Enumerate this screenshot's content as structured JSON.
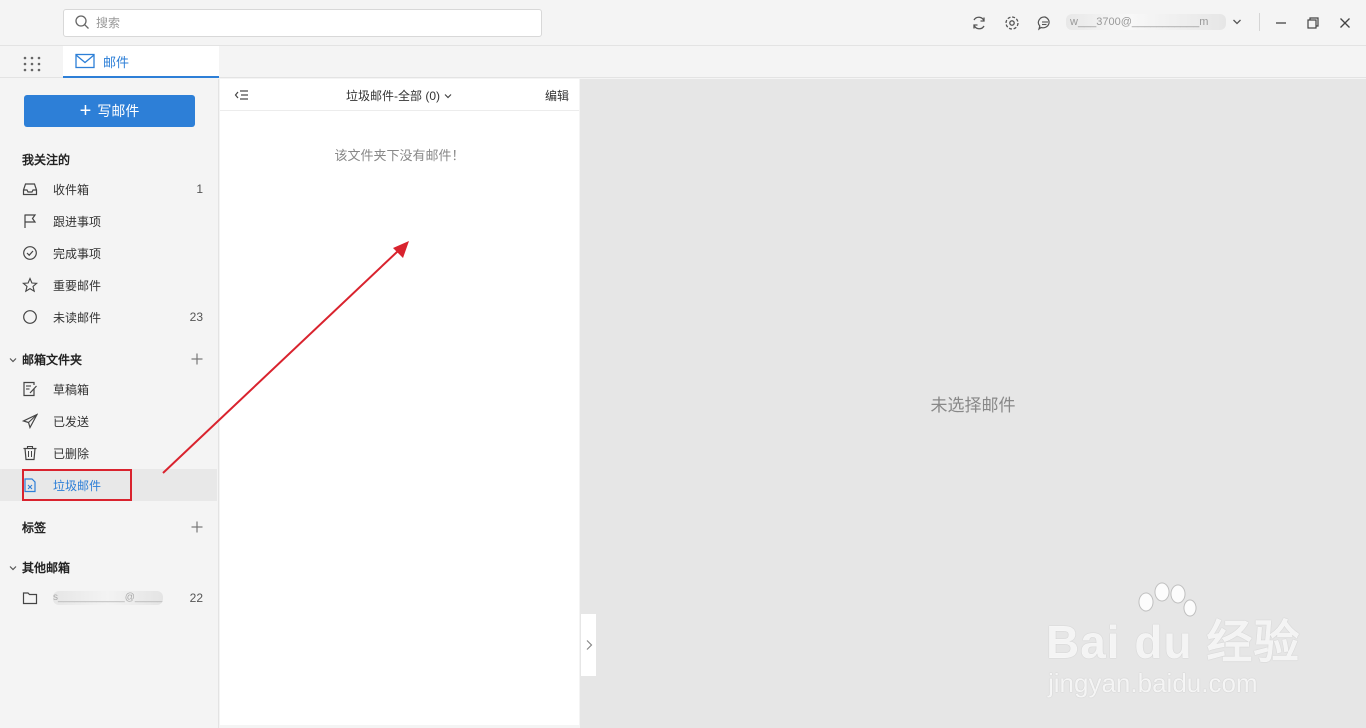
{
  "search": {
    "placeholder": "搜索"
  },
  "account": {
    "name": "w___3700@___________m"
  },
  "tabs": [
    {
      "label": "邮件"
    }
  ],
  "compose": {
    "label": "写邮件"
  },
  "sections": {
    "favorites": {
      "title": "我关注的",
      "items": [
        {
          "label": "收件箱",
          "count": "1",
          "icon": "inbox-icon"
        },
        {
          "label": "跟进事项",
          "count": "",
          "icon": "flag-icon"
        },
        {
          "label": "完成事项",
          "count": "",
          "icon": "check-circle-icon"
        },
        {
          "label": "重要邮件",
          "count": "",
          "icon": "star-icon"
        },
        {
          "label": "未读邮件",
          "count": "23",
          "icon": "circle-icon"
        }
      ]
    },
    "folders": {
      "title": "邮箱文件夹",
      "items": [
        {
          "label": "草稿箱",
          "icon": "draft-icon"
        },
        {
          "label": "已发送",
          "icon": "send-icon"
        },
        {
          "label": "已删除",
          "icon": "trash-icon"
        },
        {
          "label": "垃圾邮件",
          "icon": "spam-icon"
        }
      ]
    },
    "tags": {
      "title": "标签"
    },
    "other": {
      "title": "其他邮箱",
      "items": [
        {
          "label": "s____________@______...",
          "count": "22",
          "icon": "folder-icon"
        }
      ]
    }
  },
  "list": {
    "folder_label": "垃圾邮件-全部 (0)",
    "edit_label": "编辑",
    "empty_message": "该文件夹下没有邮件！"
  },
  "reader": {
    "empty_message": "未选择邮件"
  },
  "watermark": {
    "text": "Bai du 经验",
    "url": "jingyan.baidu.com"
  },
  "colors": {
    "accent": "#2d7fd7",
    "annotation": "#d9232e",
    "reader_bg": "#e6e6e6"
  }
}
